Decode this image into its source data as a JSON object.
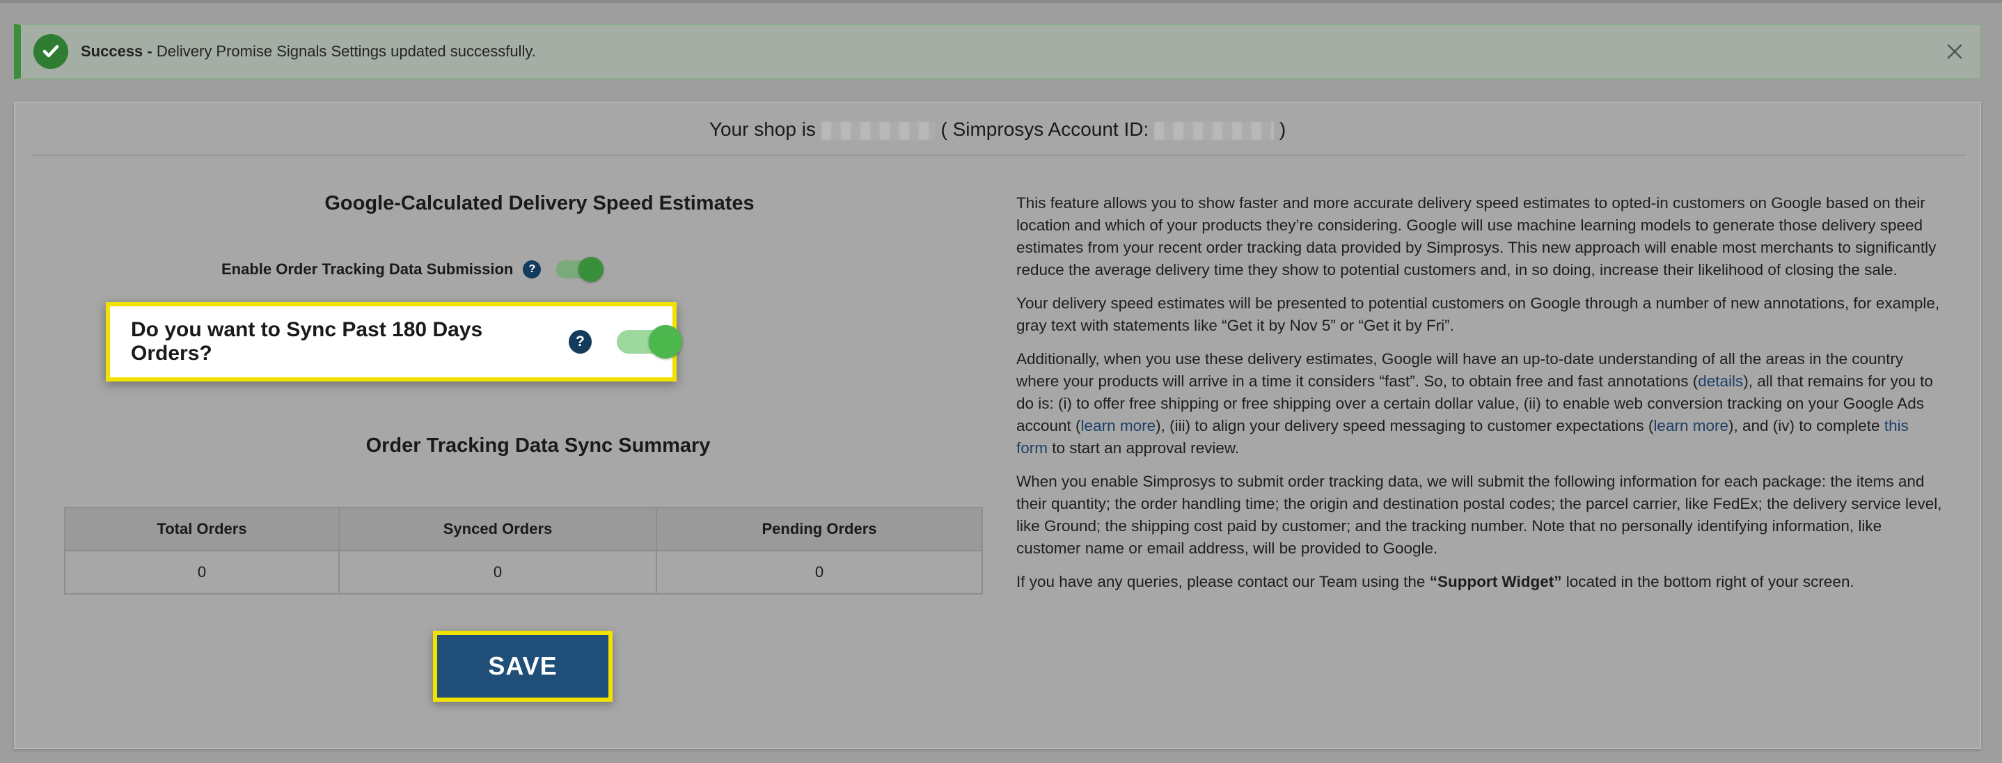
{
  "banner": {
    "status": "Success -",
    "message": "Delivery Promise Signals Settings updated successfully.",
    "icons": {
      "status": "check-circle-icon",
      "close": "close-icon"
    }
  },
  "shop": {
    "prefix": "Your shop is",
    "account_prefix": "( Simprosys Account ID:",
    "account_suffix": ")"
  },
  "delivery": {
    "title": "Google-Calculated Delivery Speed Estimates",
    "enable_tracking_label": "Enable Order Tracking Data Submission",
    "enable_tracking_on": true,
    "sync_past_label": "Do you want to Sync Past 180 Days Orders?",
    "sync_past_on": true,
    "help_glyph": "?"
  },
  "summary": {
    "title": "Order Tracking Data Sync Summary",
    "headers": [
      "Total Orders",
      "Synced Orders",
      "Pending Orders"
    ],
    "values": [
      "0",
      "0",
      "0"
    ]
  },
  "save_label": "SAVE",
  "info": {
    "p1": "This feature allows you to show faster and more accurate delivery speed estimates to opted-in customers on Google based on their location and which of your products they’re considering. Google will use machine learning models to generate those delivery speed estimates from your recent order tracking data provided by Simprosys. This new approach will enable most merchants to significantly reduce the average delivery time they show to potential customers and, in so doing, increase their likelihood of closing the sale.",
    "p2": "Your delivery speed estimates will be presented to potential customers on Google through a number of new annotations, for example, gray text with statements like “Get it by Nov 5” or “Get it by Fri”.",
    "p3_a": "Additionally, when you use these delivery estimates, Google will have an up-to-date understanding of all the areas in the country where your products will arrive in a time it considers “fast”. So, to obtain free and fast annotations (",
    "p3_link1": "details",
    "p3_b": "), all that remains for you to do is: (i) to offer free shipping or free shipping over a certain dollar value, (ii) to enable web conversion tracking on your Google Ads account (",
    "p3_link2": "learn more",
    "p3_c": "), (iii) to align your delivery speed messaging to customer expectations (",
    "p3_link3": "learn more",
    "p3_d": "), and (iv) to complete ",
    "p3_link4": "this form",
    "p3_e": " to start an approval review.",
    "p4": "When you enable Simprosys to submit order tracking data, we will submit the following information for each package: the items and their quantity; the order handling time; the origin and destination postal codes; the parcel carrier, like FedEx; the delivery service level, like Ground; the shipping cost paid by customer; and the tracking number. Note that no personally identifying information, like customer name or email address, will be provided to Google.",
    "p5_a": "If you have any queries, please contact our Team using the ",
    "p5_b": "“Support Widget”",
    "p5_c": " located in the bottom right of your screen."
  },
  "colors": {
    "success": "#2e7d32",
    "primary": "#1f4e79",
    "highlight": "#f2e200",
    "toggle_on": "#4cb74c"
  }
}
